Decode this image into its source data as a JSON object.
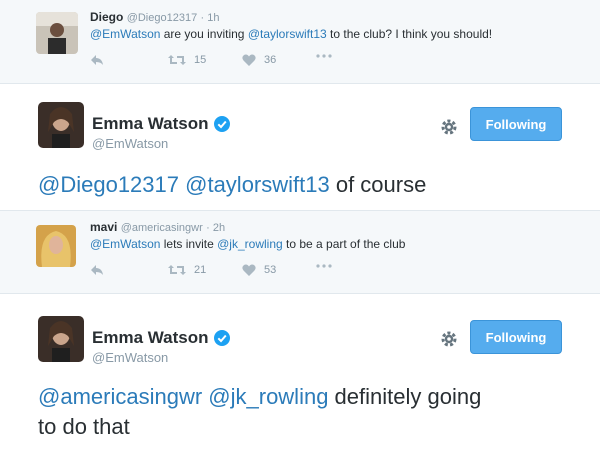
{
  "tweet1": {
    "name": "Diego",
    "handle": "@Diego12317",
    "time": "· 1h",
    "mentions": [
      "@EmWatson",
      "@taylorswift13"
    ],
    "text_a": " are you inviting ",
    "text_b": " to the club? I think you should!",
    "retweets": "15",
    "likes": "36"
  },
  "reply1": {
    "name": "Emma Watson",
    "handle": "@EmWatson",
    "follow_label": "Following",
    "mentions": [
      "@Diego12317",
      "@taylorswift13"
    ],
    "text_end": " of course"
  },
  "tweet2": {
    "name": "mavi",
    "handle": "@americasingwr",
    "time": "· 2h",
    "mentions": [
      "@EmWatson",
      "@jk_rowling"
    ],
    "text_a": " lets invite ",
    "text_b": " to be a part of the club",
    "retweets": "21",
    "likes": "53"
  },
  "reply2": {
    "name": "Emma Watson",
    "handle": "@EmWatson",
    "follow_label": "Following",
    "mentions": [
      "@americasingwr",
      "@jk_rowling"
    ],
    "text_line1_end": " definitely going",
    "text_line2": "to do that"
  },
  "colors": {
    "link": "#2b7bb9",
    "follow_button": "#55acee",
    "verified": "#1da1f2"
  },
  "icons": [
    "reply-icon",
    "retweet-icon",
    "like-icon",
    "more-icon",
    "gear-icon",
    "verified-badge-icon"
  ]
}
